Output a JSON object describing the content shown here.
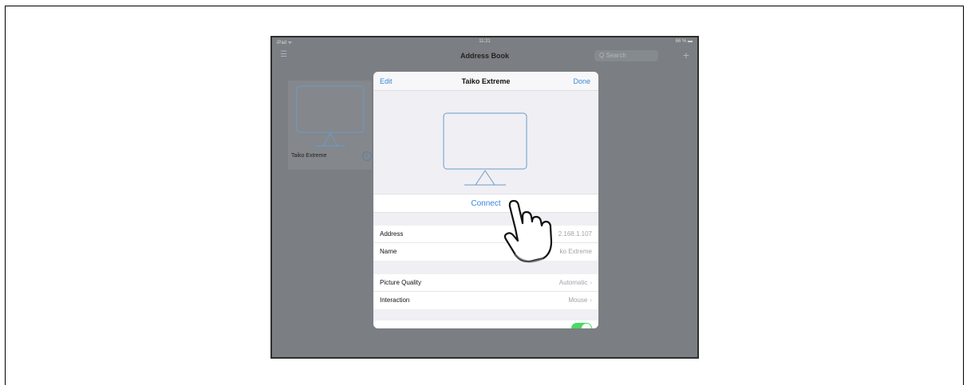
{
  "status": {
    "carrier": "iPad ᯤ",
    "time": "11:21",
    "battery": "66 % ▬"
  },
  "nav": {
    "title": "Address Book",
    "search_placeholder": "Q Search",
    "menu_icon": "list-icon",
    "add_icon": "plus-icon"
  },
  "tile": {
    "label": "Taiko Extreme",
    "info_icon": "info-icon"
  },
  "sheet": {
    "edit_label": "Edit",
    "title": "Taiko Extreme",
    "done_label": "Done",
    "connect_label": "Connect",
    "rows": [
      {
        "key": "Address",
        "value": "2.168.1.107"
      },
      {
        "key": "Name",
        "value": "ko Extreme"
      }
    ],
    "settings": [
      {
        "key": "Picture Quality",
        "value": "Automatic"
      },
      {
        "key": "Interaction",
        "value": "Mouse"
      }
    ],
    "toggle_on": true
  },
  "colors": {
    "accent": "#3a86d6",
    "toggle": "#4cd964",
    "overlay": "#7b7e82"
  }
}
